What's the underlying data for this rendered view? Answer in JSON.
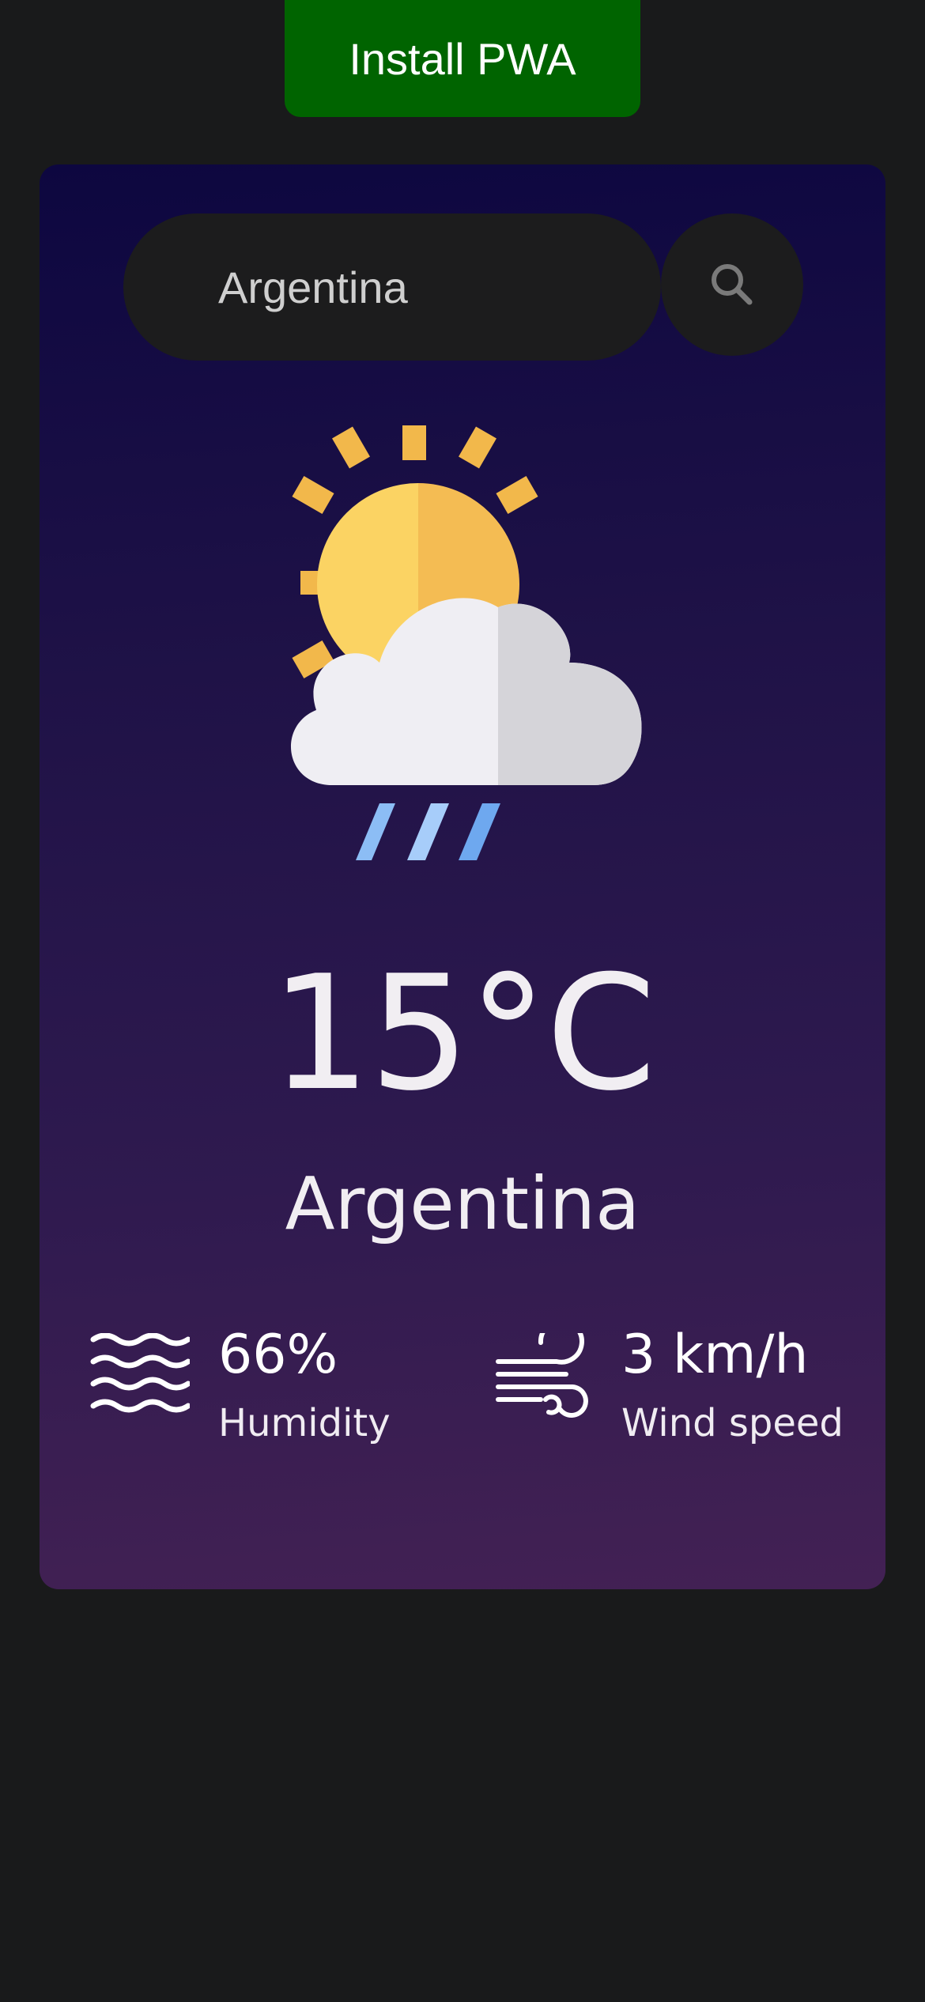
{
  "install_button": {
    "label": "Install PWA"
  },
  "search": {
    "value": "Argentina"
  },
  "weather": {
    "icon": "partly-cloudy-rain-icon",
    "temperature": "15°C",
    "city": "Argentina"
  },
  "stats": {
    "humidity": {
      "icon": "humidity-waves-icon",
      "value": "66%",
      "label": "Humidity"
    },
    "wind": {
      "icon": "wind-icon",
      "value": "3 km/h",
      "label": "Wind speed"
    }
  },
  "colors": {
    "install_button_bg": "#006400",
    "page_bg": "#191a1b",
    "card_gradient_top": "#0d0740",
    "card_gradient_bottom": "#432154",
    "search_bg": "#1c1c1d"
  }
}
